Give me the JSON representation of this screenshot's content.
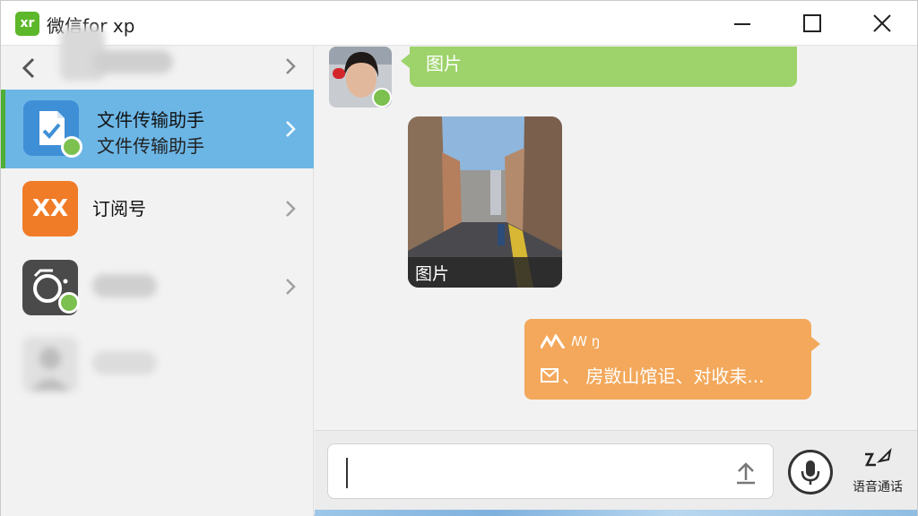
{
  "window": {
    "logo_text": "xr",
    "title": "微信for xp"
  },
  "sidebar": {
    "items": [
      {
        "id": "back-row",
        "title": "",
        "blurred": true
      },
      {
        "id": "file-transfer",
        "title": "文件传输助手",
        "subtitle": "文件传输助手",
        "selected": true
      },
      {
        "id": "subscriptions",
        "title": "订阅号",
        "icon_text": "XX"
      },
      {
        "id": "camera-chat",
        "title": "",
        "blurred": true
      },
      {
        "id": "contact",
        "title": "",
        "blurred": true
      }
    ]
  },
  "chat": {
    "messages": [
      {
        "type": "text",
        "side": "left",
        "text": "图片"
      },
      {
        "type": "image",
        "side": "left",
        "caption": "图片"
      },
      {
        "type": "text",
        "side": "right",
        "header": "ꟿ ŋ",
        "text": "、 房敳山馆讵、对收耒..."
      }
    ]
  },
  "input": {
    "value": "",
    "voice_call_label": "语音通话"
  },
  "colors": {
    "selected_row": "#6cb6e6",
    "accent_green": "#5cb82a",
    "bubble_green": "#9dd36a",
    "bubble_orange": "#f3a85b"
  }
}
